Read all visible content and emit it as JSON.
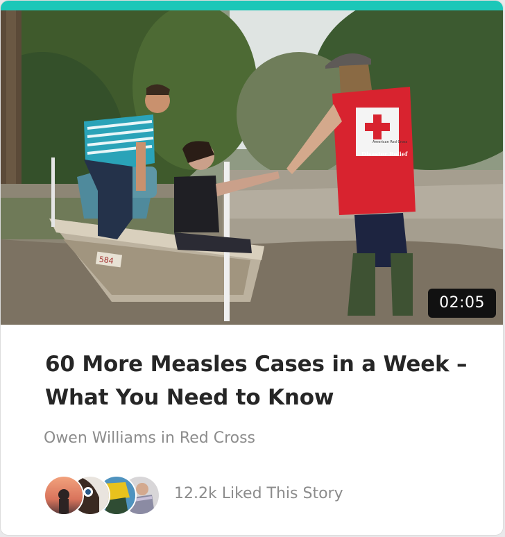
{
  "story": {
    "duration": "02:05",
    "title": "60 More Measles Cases in a Week – What You Need to Know",
    "author": "Owen Williams",
    "byline": "Owen Williams in Red Cross",
    "channel": "Red Cross",
    "likes_text": "12.2k Liked This Story"
  },
  "photo": {
    "vest_text_1": "American Red Cross",
    "vest_text_2": "Disaster Relief",
    "boat_text": "584"
  },
  "colors": {
    "accent": "#1cc7b8",
    "red_vest": "#d8232f",
    "title": "#262626",
    "muted": "#8c8c8c"
  },
  "avatars": [
    {
      "name": "avatar-1",
      "icon": "sunset-photo"
    },
    {
      "name": "avatar-2",
      "icon": "camera-person-photo"
    },
    {
      "name": "avatar-3",
      "icon": "yellow-hat-photo"
    },
    {
      "name": "avatar-4",
      "icon": "woman-scarf-photo"
    }
  ]
}
